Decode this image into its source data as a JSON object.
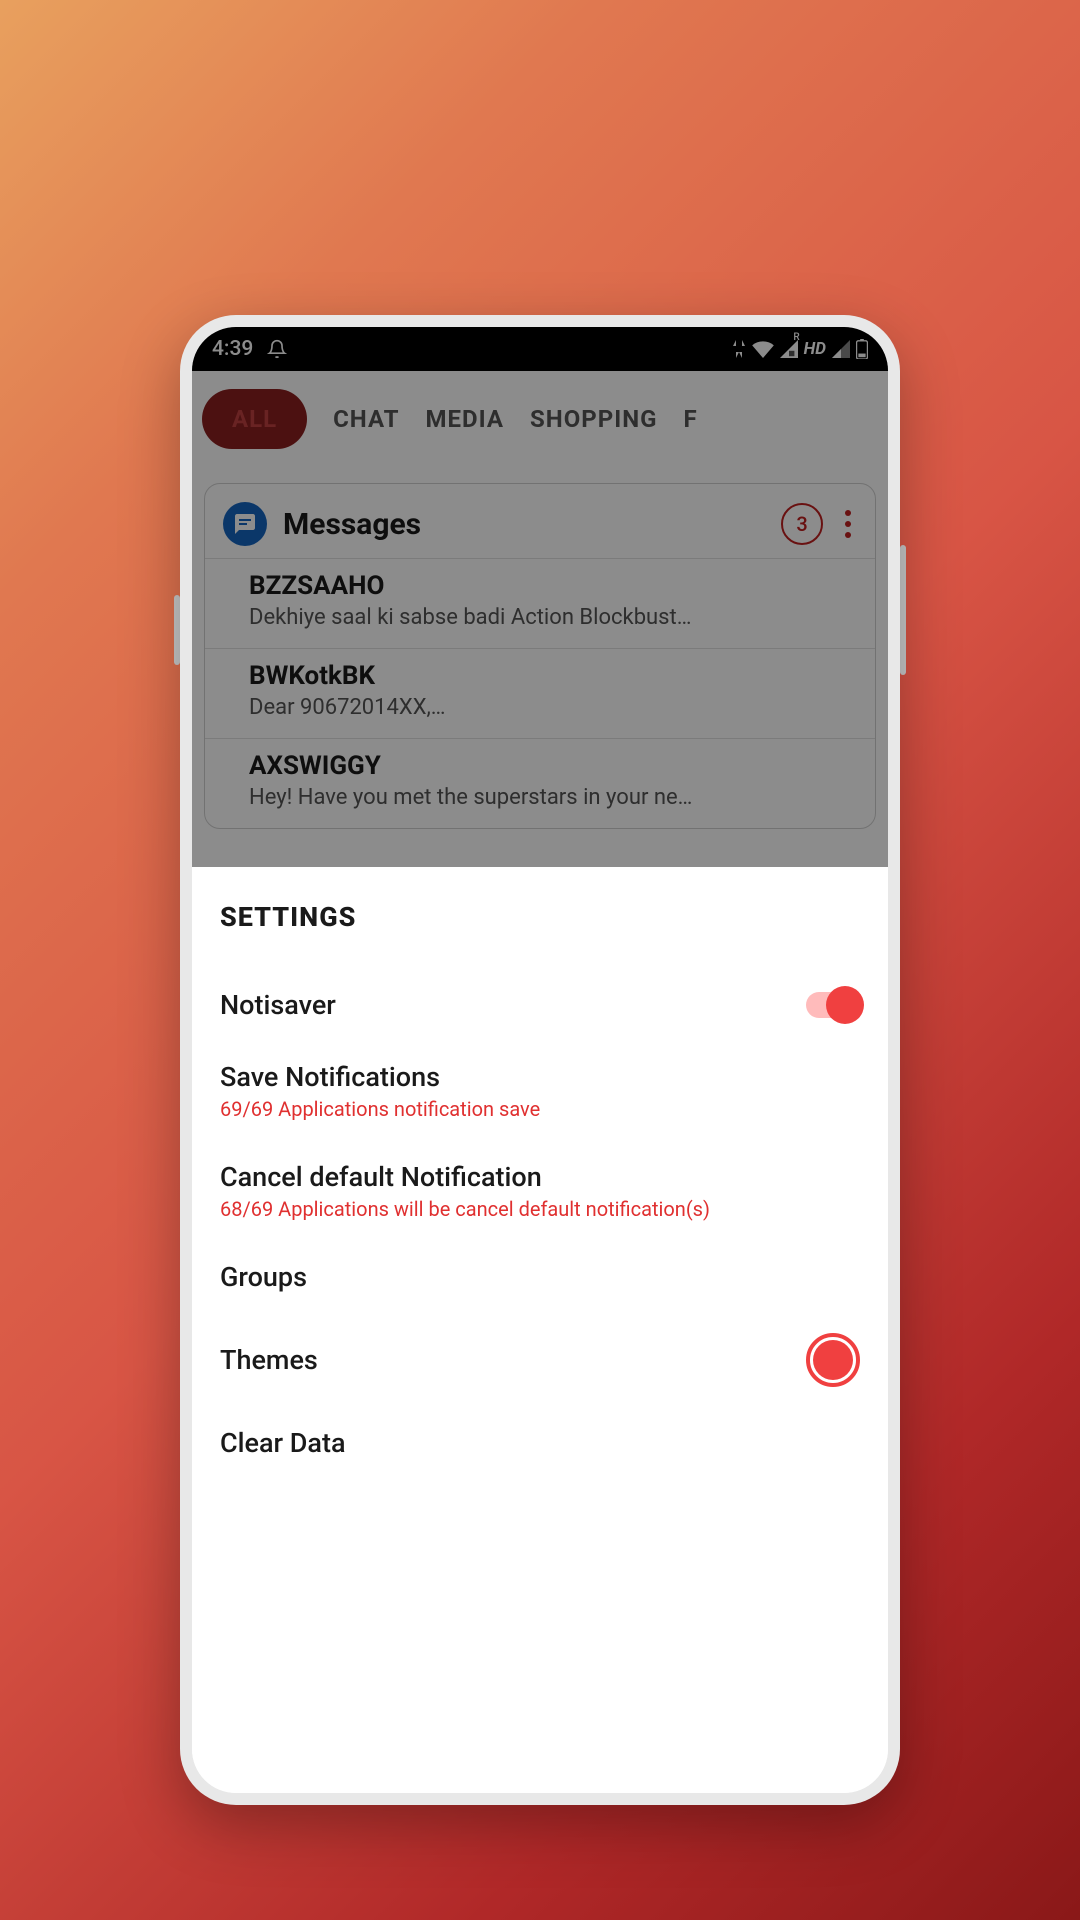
{
  "status": {
    "time": "4:39",
    "hd": "HD"
  },
  "tabs": {
    "all": "ALL",
    "chat": "CHAT",
    "media": "MEDIA",
    "shopping": "SHOPPING",
    "last": "F"
  },
  "card": {
    "app_name": "Messages",
    "count": "3",
    "items": [
      {
        "title": "BZZSAAHO",
        "preview": "Dekhiye saal ki sabse badi Action Blockbust…"
      },
      {
        "title": "BWKotkBK",
        "preview": "Dear 90672014XX,…"
      },
      {
        "title": "AXSWIGGY",
        "preview": "Hey! Have you met the superstars in your ne…"
      }
    ]
  },
  "settings": {
    "title": "SETTINGS",
    "notisaver": "Notisaver",
    "save_notif": "Save Notifications",
    "save_notif_sub": "69/69 Applications notification save",
    "cancel_notif": "Cancel default Notification",
    "cancel_notif_sub": "68/69 Applications will be cancel default notification(s)",
    "groups": "Groups",
    "themes": "Themes",
    "clear_data": "Clear Data"
  }
}
